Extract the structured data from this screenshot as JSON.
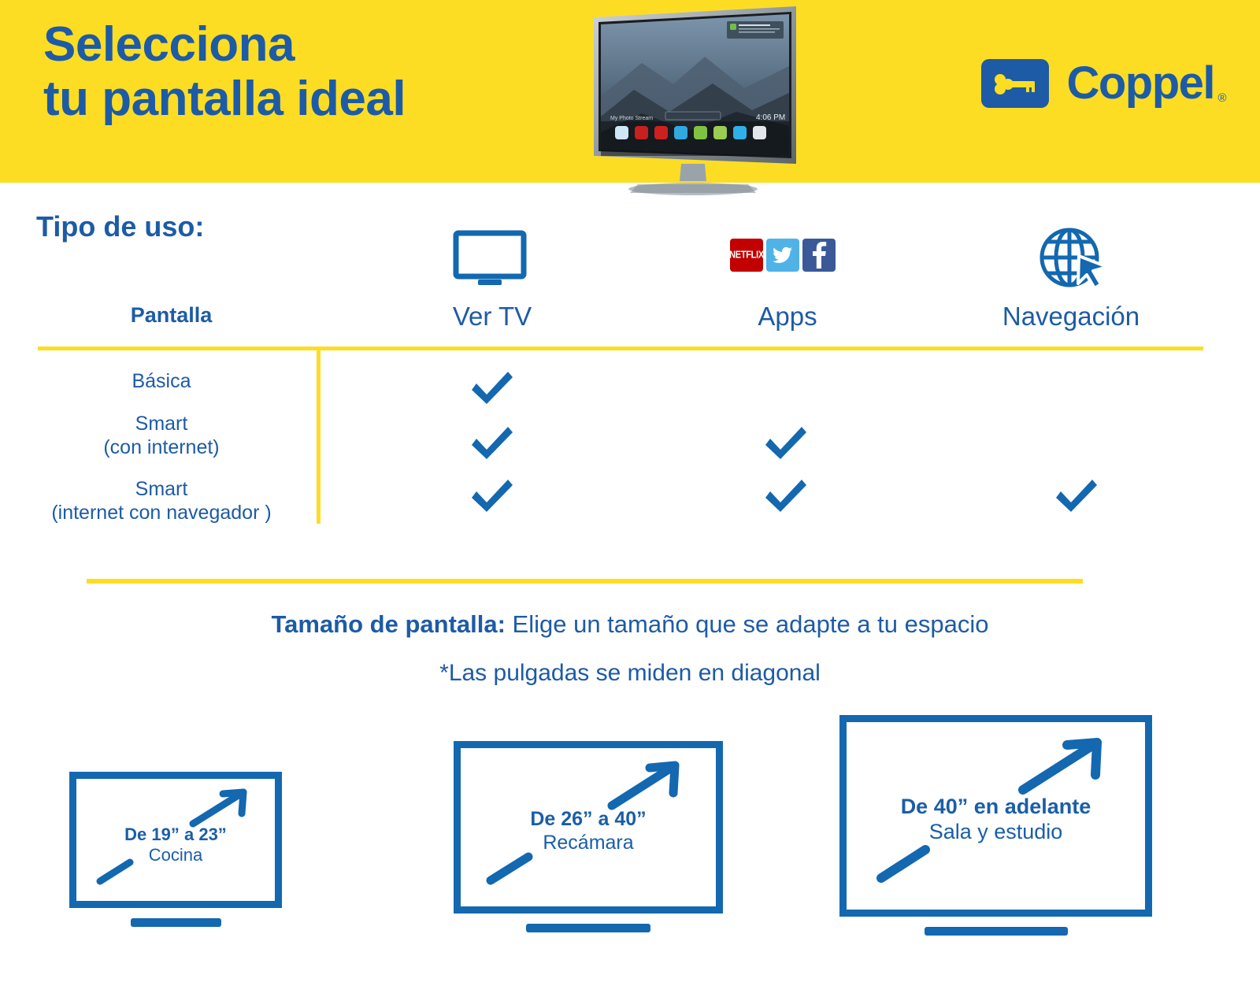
{
  "brand": {
    "yellow": "#fcdd24",
    "blue": "#1d5ba6",
    "tv_blue": "#1368b0",
    "logo_text": "Coppel",
    "logo_registered": "®",
    "logo_icon": "key-icon"
  },
  "header": {
    "title_line1": "Selecciona",
    "title_line2": "tu pantalla ideal",
    "tv_photo": {
      "icon": "smart-tv-photo",
      "screen_clock": "4:06 PM",
      "screen_label": "My Photo Stream"
    }
  },
  "usage": {
    "section_title": "Tipo de uso:",
    "columns": [
      {
        "label": "Pantalla",
        "icon": "none"
      },
      {
        "label": "Ver TV",
        "icon": "monitor-icon"
      },
      {
        "label": "Apps",
        "icon": "app-badges-icon"
      },
      {
        "label": "Navegación",
        "icon": "globe-cursor-icon"
      }
    ],
    "app_badges": [
      {
        "name": "netflix-icon",
        "text": "NETFLIX",
        "color": "#c20000"
      },
      {
        "name": "twitter-icon",
        "text": "",
        "color": "#4fb3e8"
      },
      {
        "name": "facebook-icon",
        "text": "",
        "color": "#3b5998"
      }
    ],
    "rows": [
      {
        "label_line1": "Básica",
        "label_line2": "",
        "ver_tv": true,
        "apps": false,
        "navegacion": false
      },
      {
        "label_line1": "Smart",
        "label_line2": "(con internet)",
        "ver_tv": true,
        "apps": true,
        "navegacion": false
      },
      {
        "label_line1": "Smart",
        "label_line2": "(internet con navegador )",
        "ver_tv": true,
        "apps": true,
        "navegacion": true
      }
    ]
  },
  "size": {
    "heading_strong": "Tamaño de pantalla:",
    "heading_rest": " Elige un tamaño que se adapte a tu espacio",
    "note": "*Las pulgadas se miden en diagonal",
    "boxes": [
      {
        "range": "De 19” a 23”",
        "room": "Cocina",
        "icon": "tv-outline-icon"
      },
      {
        "range": "De 26” a 40”",
        "room": "Recámara",
        "icon": "tv-outline-icon"
      },
      {
        "range": "De 40” en adelante",
        "room": "Sala y estudio",
        "icon": "tv-outline-icon"
      }
    ]
  }
}
